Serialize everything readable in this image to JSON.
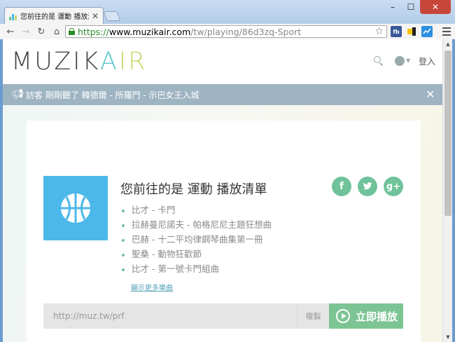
{
  "browser": {
    "tab_title": "您前往的是 運動 播放清單",
    "url_scheme": "https://",
    "url_host": "www.muzikair.com",
    "url_path": "/tw/playing/86d3zq-Sport",
    "ext_fb": "fb",
    "close_glyph": "✕",
    "minimize_glyph": "–",
    "maximize_glyph": "☐"
  },
  "site": {
    "logo_main": "MUZIK",
    "logo_a": "A",
    "logo_ir": "IR",
    "login": "登入"
  },
  "notice": {
    "text": "訪客 剛剛聽了 韓德爾 - 所羅門 - 示巴女王入城",
    "close": "✕"
  },
  "playlist": {
    "title": "您前往的是 運動 播放清單",
    "tracks": [
      "比才 - 卡門",
      "拉赫曼尼諾夫 - 帕格尼尼主題狂想曲",
      "巴赫 - 十二平均律鋼琴曲集第一冊",
      "聖桑 - 動物狂歡節",
      "比才 - 第一號卡門組曲"
    ],
    "more_link": "顯示更多樂曲",
    "share_icons": [
      "facebook-icon",
      "twitter-icon",
      "google-plus-icon"
    ],
    "share_labels": [
      "f",
      "t",
      "g+"
    ]
  },
  "share_bar": {
    "url": "http://muz.tw/prf",
    "copy": "複製",
    "play": "立即播放"
  },
  "colors": {
    "accent_green": "#6fc29a",
    "art_blue": "#4bb8e9",
    "notice_bg": "#9fb4c3"
  }
}
